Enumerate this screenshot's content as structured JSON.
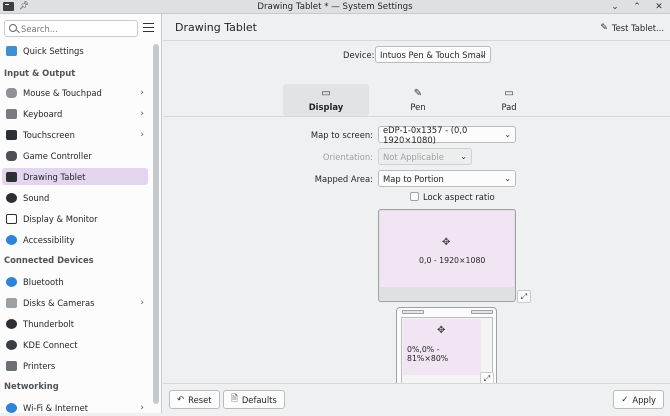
{
  "window": {
    "title": "Drawing Tablet * — System Settings"
  },
  "search": {
    "placeholder": "Search..."
  },
  "sidebar": {
    "quick": {
      "label": "Quick Settings"
    },
    "sections": [
      {
        "header": "Input & Output"
      },
      {
        "header": "Connected Devices"
      },
      {
        "header": "Networking"
      }
    ],
    "items": [
      {
        "label": "Mouse & Touchpad"
      },
      {
        "label": "Keyboard"
      },
      {
        "label": "Touchscreen"
      },
      {
        "label": "Game Controller"
      },
      {
        "label": "Drawing Tablet"
      },
      {
        "label": "Sound"
      },
      {
        "label": "Display & Monitor"
      },
      {
        "label": "Accessibility"
      },
      {
        "label": "Bluetooth"
      },
      {
        "label": "Disks & Cameras"
      },
      {
        "label": "Thunderbolt"
      },
      {
        "label": "KDE Connect"
      },
      {
        "label": "Printers"
      },
      {
        "label": "Wi-Fi & Internet"
      }
    ]
  },
  "page": {
    "title": "Drawing Tablet",
    "test_label": "Test Tablet..."
  },
  "device": {
    "label": "Device:",
    "value": "Intuos Pen & Touch Small"
  },
  "tabs": [
    {
      "label": "Display"
    },
    {
      "label": "Pen"
    },
    {
      "label": "Pad"
    }
  ],
  "form": {
    "map_label": "Map to screen:",
    "map_value": "eDP-1-0x1357 - (0,0 1920×1080)",
    "orientation_label": "Orientation:",
    "orientation_value": "Not Applicable",
    "area_label": "Mapped Area:",
    "area_value": "Map to Portion",
    "lock_label": "Lock aspect ratio"
  },
  "preview": {
    "screen_text": "0,0 - 1920×1080",
    "tablet_text": "0%,0% - 81%×80%"
  },
  "footer": {
    "reset": "Reset",
    "defaults": "Defaults",
    "apply": "Apply"
  },
  "colors": {
    "accent": "#e4d5ee",
    "mapped": "#f1e4f3"
  }
}
